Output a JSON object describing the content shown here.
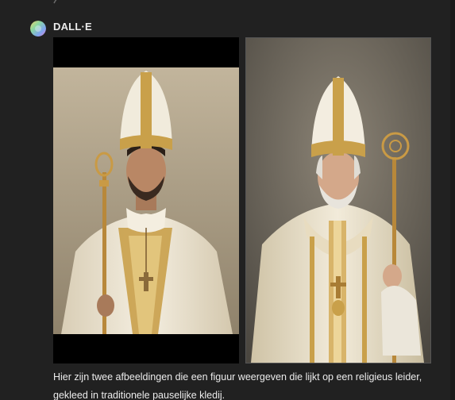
{
  "message": {
    "sender": "DALL·E",
    "avatar_icon": "dalle-avatar-icon",
    "images": [
      {
        "description_icon": "generated-image-young-bishop"
      },
      {
        "description_icon": "generated-image-elderly-pope"
      }
    ],
    "caption": "Hier zijn twee afbeeldingen die een figuur weergeven die lijkt op een religieus leider, gekleed in traditionele pauselijke kledij."
  },
  "colors": {
    "background": "#212121",
    "text": "#ececec",
    "gold": "#c9a04a",
    "robe": "#efe7d6"
  }
}
